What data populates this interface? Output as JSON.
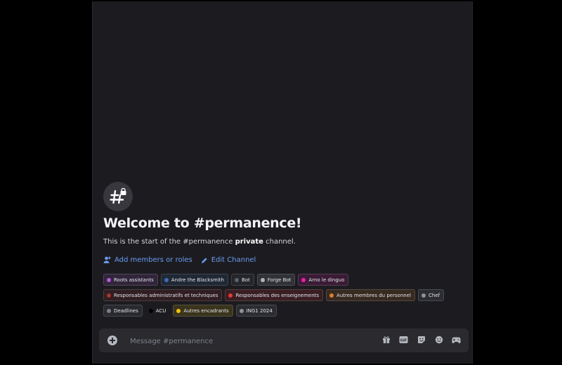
{
  "welcome": {
    "title": "Welcome to #permanence!",
    "subtitle_pre": "This is the start of the #permanence ",
    "subtitle_bold": "private",
    "subtitle_post": " channel."
  },
  "actions": {
    "add_members": "Add members or roles",
    "edit_channel": "Edit Channel"
  },
  "roles": [
    {
      "label": "Roots assistants",
      "color": "#b05bd6",
      "plain": false
    },
    {
      "label": "Andre the Blacksmith",
      "color": "#3c6fb0",
      "plain": false
    },
    {
      "label": "Bot",
      "color": "#5a6370",
      "plain": false
    },
    {
      "label": "Forge Bot",
      "color": "#aeb3ba",
      "plain": false
    },
    {
      "label": "Arno le dinguo",
      "color": "#e91eb0",
      "plain": false
    },
    {
      "label": "Responsables administratifs et techniques",
      "color": "#a8322d",
      "plain": false
    },
    {
      "label": "Responsables des enseignements",
      "color": "#e53935",
      "plain": false
    },
    {
      "label": "Autres membres du personnel",
      "color": "#d9822b",
      "plain": false
    },
    {
      "label": "Chef",
      "color": "#8e9297",
      "plain": false
    },
    {
      "label": "Deadlines",
      "color": "#7b7f86",
      "plain": false
    },
    {
      "label": "ACU",
      "color": "#000000",
      "plain": true
    },
    {
      "label": "Autres encadrants",
      "color": "#f1c40f",
      "plain": false
    },
    {
      "label": "ING1 2024",
      "color": "#8e9297",
      "plain": false
    }
  ],
  "composer": {
    "placeholder": "Message #permanence"
  },
  "tools": [
    "gift-icon",
    "gif-icon",
    "sticker-icon",
    "emoji-icon",
    "apps-icon"
  ]
}
